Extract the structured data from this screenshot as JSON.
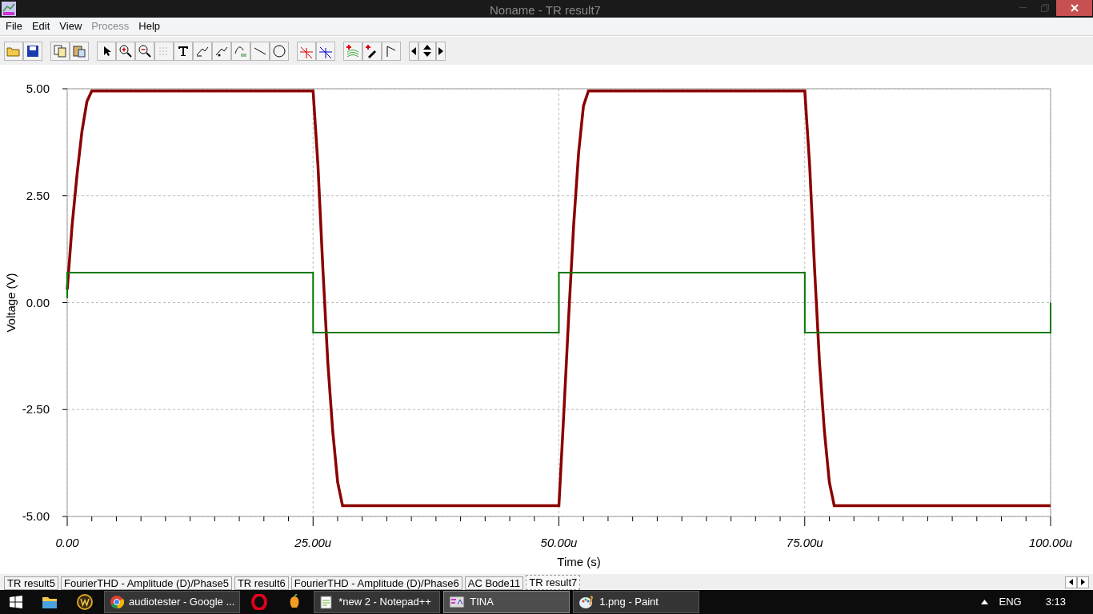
{
  "window": {
    "title": "Noname - TR result7"
  },
  "menu": [
    {
      "label": "File",
      "disabled": false
    },
    {
      "label": "Edit",
      "disabled": false
    },
    {
      "label": "View",
      "disabled": false
    },
    {
      "label": "Process",
      "disabled": true
    },
    {
      "label": "Help",
      "disabled": false
    }
  ],
  "chart": {
    "chart_data": {
      "type": "line",
      "xlabel": "Time (s)",
      "ylabel": "Voltage (V)",
      "x": [
        0,
        0,
        0.5,
        1,
        1.5,
        2,
        2.5,
        25,
        25,
        25.5,
        26,
        26.5,
        27,
        27.5,
        28,
        28.5,
        50,
        50,
        50.5,
        51,
        51.5,
        52,
        52.5,
        53,
        53.5,
        75,
        75,
        75.5,
        76,
        76.5,
        77,
        77.5,
        78,
        78.5,
        100,
        100
      ],
      "series": [
        {
          "color": "#8b0000",
          "values": [
            0.3,
            0.3,
            1.8,
            3.0,
            4.0,
            4.7,
            4.95,
            4.95,
            4.95,
            3.2,
            0.8,
            -1.4,
            -3.0,
            -4.2,
            -4.75,
            -4.75,
            -4.75,
            -4.75,
            -2.6,
            -0.3,
            1.8,
            3.5,
            4.6,
            4.95,
            4.95,
            4.95,
            4.95,
            3.2,
            0.8,
            -1.4,
            -3.0,
            -4.2,
            -4.75,
            -4.75,
            -4.75,
            -4.75
          ]
        },
        {
          "color": "#007800",
          "values": [
            0.1,
            0.7,
            0.7,
            0.7,
            0.7,
            0.7,
            0.7,
            0.7,
            -0.7,
            -0.7,
            -0.7,
            -0.7,
            -0.7,
            -0.7,
            -0.7,
            -0.7,
            -0.7,
            0.7,
            0.7,
            0.7,
            0.7,
            0.7,
            0.7,
            0.7,
            0.7,
            0.7,
            -0.7,
            -0.7,
            -0.7,
            -0.7,
            -0.7,
            -0.7,
            -0.7,
            -0.7,
            -0.7,
            0
          ]
        }
      ],
      "grid": true,
      "xlim": [
        0,
        100
      ],
      "ylim": [
        -5,
        5
      ],
      "xticks": [
        {
          "value": 0,
          "label": "0.00"
        },
        {
          "value": 25,
          "label": "25.00u"
        },
        {
          "value": 50,
          "label": "50.00u"
        },
        {
          "value": 75,
          "label": "75.00u"
        },
        {
          "value": 100,
          "label": "100.00u"
        }
      ],
      "yticks": [
        {
          "value": -5,
          "label": "-5.00"
        },
        {
          "value": -2.5,
          "label": "-2.50"
        },
        {
          "value": 0,
          "label": "0.00"
        },
        {
          "value": 2.5,
          "label": "2.50"
        },
        {
          "value": 5,
          "label": "5.00"
        }
      ]
    }
  },
  "tabs": [
    {
      "label": "TR result5",
      "selected": false
    },
    {
      "label": "FourierTHD - Amplitude (D)/Phase5",
      "selected": false
    },
    {
      "label": "TR result6",
      "selected": false
    },
    {
      "label": "FourierTHD - Amplitude (D)/Phase6",
      "selected": false
    },
    {
      "label": "AC Bode11",
      "selected": false
    },
    {
      "label": "TR result7",
      "selected": true
    }
  ],
  "taskbar": {
    "apps": [
      {
        "kind": "folder"
      },
      {
        "kind": "game"
      },
      {
        "kind": "browser",
        "label": "audiotester - Google ...",
        "active": false
      },
      {
        "kind": "opera"
      },
      {
        "kind": "fruit"
      },
      {
        "kind": "notepad",
        "label": "*new  2 - Notepad++",
        "active": false
      },
      {
        "kind": "tina",
        "label": "TINA",
        "active": true
      },
      {
        "kind": "paint",
        "label": "1.png - Paint",
        "active": false
      }
    ],
    "language": "ENG",
    "clock": "3:13"
  }
}
